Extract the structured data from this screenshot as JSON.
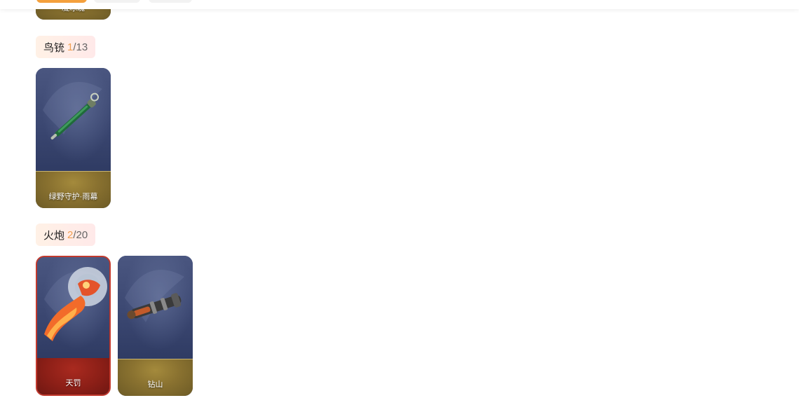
{
  "top_card": {
    "name": "凝冰魄"
  },
  "sections": [
    {
      "name": "鸟铳",
      "owned": "1",
      "separator": "/",
      "total": "13",
      "items": [
        {
          "name": "绿野守护·雨幕"
        }
      ]
    },
    {
      "name": "火炮",
      "owned": "2",
      "separator": "/",
      "total": "20",
      "items": [
        {
          "name": "天罚"
        },
        {
          "name": "钻山"
        }
      ]
    }
  ],
  "icons": {
    "musket": "green-musket-icon",
    "cannon_red": "flame-cannon-icon",
    "cannon_drill": "drill-cannon-icon"
  },
  "colors": {
    "owned_count": "#f0a052",
    "active_tab": "#f4a03c",
    "legendary_frame": "#c23a2e",
    "card_bg": "#34416a",
    "card_base_gold": "#8a7230"
  }
}
